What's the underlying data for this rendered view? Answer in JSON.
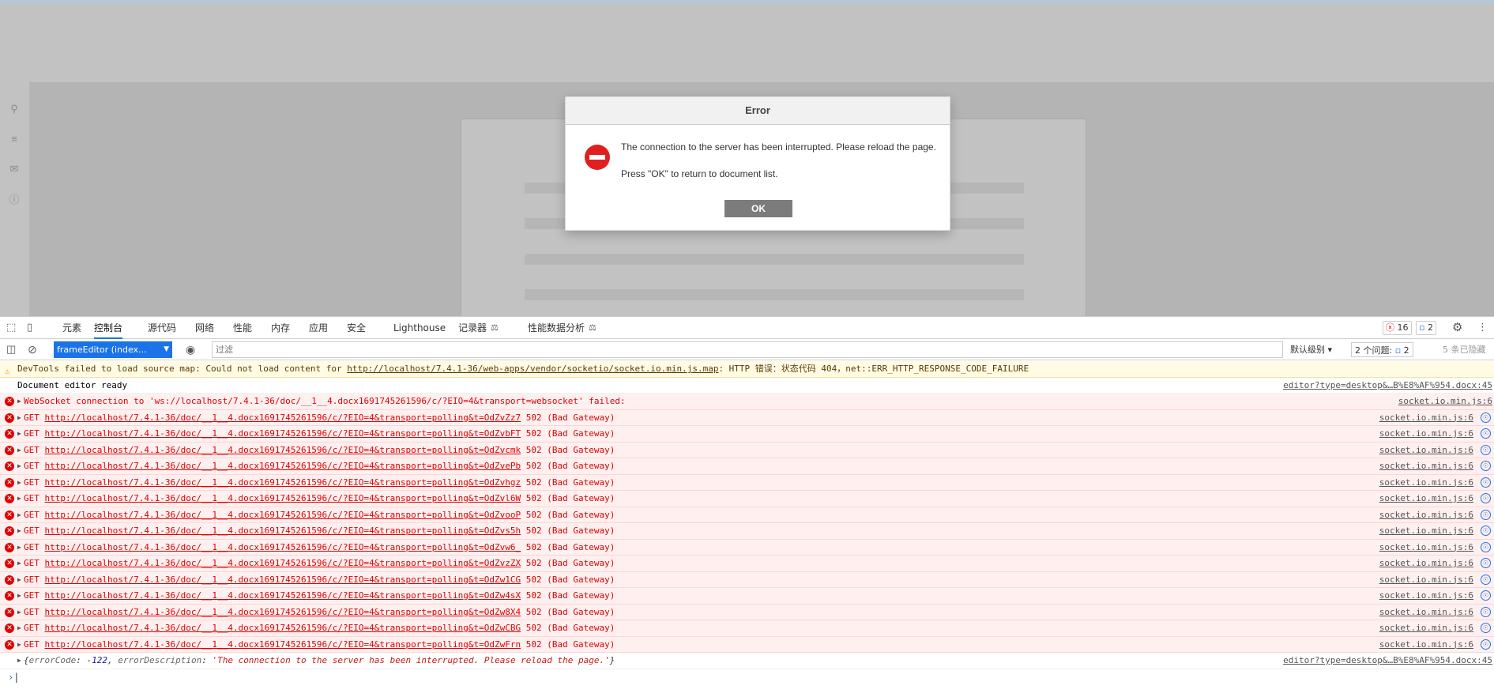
{
  "dialog": {
    "title": "Error",
    "message": "The connection to the server has been interrupted. Please reload the page.",
    "hint": "Press \"OK\" to return to document list.",
    "ok_label": "OK"
  },
  "devtools": {
    "tabs": [
      "元素",
      "控制台",
      "源代码",
      "网络",
      "性能",
      "内存",
      "应用",
      "安全",
      "Lighthouse",
      "记录器",
      "性能数据分析"
    ],
    "active_tab": "控制台",
    "error_count": "16",
    "issue_count": "2",
    "context": "frameEditor (index...",
    "filter_placeholder": "过滤",
    "level": "默认级别",
    "issues_label": "2 个问题:",
    "issues_badge": "2",
    "hidden_label": "5 条已隐藏"
  },
  "console": {
    "warning": {
      "text_prefix": "DevTools failed to load source map: Could not load content for ",
      "url": "http://localhost/7.4.1-36/web-apps/vendor/socketio/socket.io.min.js.map",
      "text_suffix": ": HTTP 错误：状态代码 404，net::ERR_HTTP_RESPONSE_CODE_FAILURE"
    },
    "info": {
      "text": "Document editor ready",
      "source": "editor?type=desktop&…B%E8%AF%954.docx:45"
    },
    "websocket": {
      "text": "WebSocket connection to 'ws://localhost/7.4.1-36/doc/__1__4.docx1691745261596/c/?EIO=4&transport=websocket' failed:",
      "source": "socket.io.min.js:6"
    },
    "get_errors": [
      {
        "method": "GET",
        "url": "http://localhost/7.4.1-36/doc/__1__4.docx1691745261596/c/?EIO=4&transport=polling&t=OdZvZz7",
        "status": "502 (Bad Gateway)",
        "source": "socket.io.min.js:6"
      },
      {
        "method": "GET",
        "url": "http://localhost/7.4.1-36/doc/__1__4.docx1691745261596/c/?EIO=4&transport=polling&t=OdZvbFT",
        "status": "502 (Bad Gateway)",
        "source": "socket.io.min.js:6"
      },
      {
        "method": "GET",
        "url": "http://localhost/7.4.1-36/doc/__1__4.docx1691745261596/c/?EIO=4&transport=polling&t=OdZvcmk",
        "status": "502 (Bad Gateway)",
        "source": "socket.io.min.js:6"
      },
      {
        "method": "GET",
        "url": "http://localhost/7.4.1-36/doc/__1__4.docx1691745261596/c/?EIO=4&transport=polling&t=OdZvePb",
        "status": "502 (Bad Gateway)",
        "source": "socket.io.min.js:6"
      },
      {
        "method": "GET",
        "url": "http://localhost/7.4.1-36/doc/__1__4.docx1691745261596/c/?EIO=4&transport=polling&t=OdZvhgz",
        "status": "502 (Bad Gateway)",
        "source": "socket.io.min.js:6"
      },
      {
        "method": "GET",
        "url": "http://localhost/7.4.1-36/doc/__1__4.docx1691745261596/c/?EIO=4&transport=polling&t=OdZvl6W",
        "status": "502 (Bad Gateway)",
        "source": "socket.io.min.js:6"
      },
      {
        "method": "GET",
        "url": "http://localhost/7.4.1-36/doc/__1__4.docx1691745261596/c/?EIO=4&transport=polling&t=OdZvooP",
        "status": "502 (Bad Gateway)",
        "source": "socket.io.min.js:6"
      },
      {
        "method": "GET",
        "url": "http://localhost/7.4.1-36/doc/__1__4.docx1691745261596/c/?EIO=4&transport=polling&t=OdZvs5h",
        "status": "502 (Bad Gateway)",
        "source": "socket.io.min.js:6"
      },
      {
        "method": "GET",
        "url": "http://localhost/7.4.1-36/doc/__1__4.docx1691745261596/c/?EIO=4&transport=polling&t=OdZvw6_",
        "status": "502 (Bad Gateway)",
        "source": "socket.io.min.js:6"
      },
      {
        "method": "GET",
        "url": "http://localhost/7.4.1-36/doc/__1__4.docx1691745261596/c/?EIO=4&transport=polling&t=OdZvzZX",
        "status": "502 (Bad Gateway)",
        "source": "socket.io.min.js:6"
      },
      {
        "method": "GET",
        "url": "http://localhost/7.4.1-36/doc/__1__4.docx1691745261596/c/?EIO=4&transport=polling&t=OdZw1CG",
        "status": "502 (Bad Gateway)",
        "source": "socket.io.min.js:6"
      },
      {
        "method": "GET",
        "url": "http://localhost/7.4.1-36/doc/__1__4.docx1691745261596/c/?EIO=4&transport=polling&t=OdZw4sX",
        "status": "502 (Bad Gateway)",
        "source": "socket.io.min.js:6"
      },
      {
        "method": "GET",
        "url": "http://localhost/7.4.1-36/doc/__1__4.docx1691745261596/c/?EIO=4&transport=polling&t=OdZw8X4",
        "status": "502 (Bad Gateway)",
        "source": "socket.io.min.js:6"
      },
      {
        "method": "GET",
        "url": "http://localhost/7.4.1-36/doc/__1__4.docx1691745261596/c/?EIO=4&transport=polling&t=OdZwCBG",
        "status": "502 (Bad Gateway)",
        "source": "socket.io.min.js:6"
      },
      {
        "method": "GET",
        "url": "http://localhost/7.4.1-36/doc/__1__4.docx1691745261596/c/?EIO=4&transport=polling&t=OdZwFrn",
        "status": "502 (Bad Gateway)",
        "source": "socket.io.min.js:6"
      }
    ],
    "object_row": {
      "key1": "errorCode",
      "val1": "-122",
      "key2": "errorDescription",
      "val2": "'The connection to the server has been interrupted. Please reload the page.'",
      "source": "editor?type=desktop&…B%E8%AF%954.docx:45"
    },
    "prompt": "›"
  }
}
